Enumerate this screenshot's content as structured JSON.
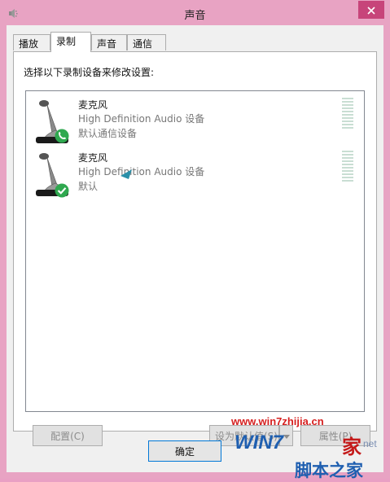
{
  "window": {
    "title": "声音"
  },
  "tabs": [
    {
      "label": "播放",
      "active": false
    },
    {
      "label": "录制",
      "active": true
    },
    {
      "label": "声音",
      "active": false
    },
    {
      "label": "通信",
      "active": false
    }
  ],
  "instruction": "选择以下录制设备来修改设置:",
  "devices": [
    {
      "name": "麦克风",
      "description": "High Definition Audio 设备",
      "status": "默认通信设备",
      "badge_icon": "phone-badge-icon",
      "badge_color": "#2fa84f"
    },
    {
      "name": "麦克风",
      "description": "High Definition Audio 设备",
      "status": "默认",
      "badge_icon": "check-badge-icon",
      "badge_color": "#2fa84f"
    }
  ],
  "buttons": {
    "configure": "配置(C)",
    "set_default": "设为默认值(S)",
    "properties": "属性(P)",
    "ok": "确定"
  },
  "watermark": {
    "url": "www.win7zhijia.cn",
    "logo": "WIN7",
    "logo_jia": "家",
    "net": "net",
    "sub": "脚本之家"
  },
  "colors": {
    "window_frame": "#e8a3c3",
    "close_button": "#c7447a",
    "accent_blue": "#0078d7",
    "badge_green": "#2fa84f"
  }
}
